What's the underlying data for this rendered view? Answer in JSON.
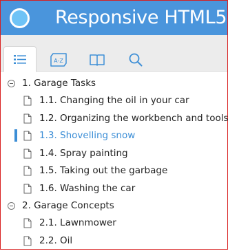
{
  "header": {
    "title": "Responsive HTML5",
    "logo_icon": "circle-logo-icon",
    "background": "#4a95dc"
  },
  "tabs": [
    {
      "name": "contents",
      "icon": "list-icon",
      "active": true
    },
    {
      "name": "index",
      "icon": "a-z-index-icon",
      "active": false
    },
    {
      "name": "glossary",
      "icon": "open-book-icon",
      "active": false
    },
    {
      "name": "search",
      "icon": "search-icon",
      "active": false
    }
  ],
  "index_icon_text": "A-Z",
  "toc": {
    "accent": "#3c8ed6",
    "chapters": [
      {
        "label": "1. Garage Tasks",
        "expanded": true,
        "topics": [
          {
            "label": "1.1. Changing the oil in your car"
          },
          {
            "label": "1.2. Organizing the workbench and tools"
          },
          {
            "label": "1.3. Shovelling snow",
            "selected": true
          },
          {
            "label": "1.4. Spray painting"
          },
          {
            "label": "1.5. Taking out the garbage"
          },
          {
            "label": "1.6. Washing the car"
          }
        ]
      },
      {
        "label": "2. Garage Concepts",
        "expanded": true,
        "topics": [
          {
            "label": "2.1. Lawnmower"
          },
          {
            "label": "2.2. Oil"
          }
        ]
      }
    ]
  }
}
